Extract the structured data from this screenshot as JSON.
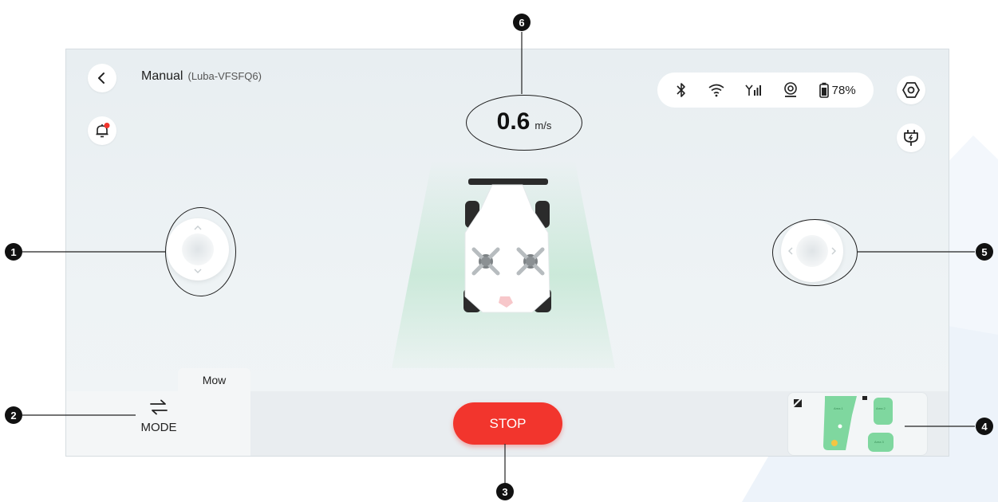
{
  "header": {
    "title": "Manual",
    "device": "(Luba-VFSFQ6)"
  },
  "status": {
    "battery": "78%",
    "icons": [
      "bluetooth-icon",
      "wifi-icon",
      "cellular-signal-icon",
      "gps-rtk-icon",
      "battery-icon"
    ]
  },
  "speed": {
    "value": "0.6",
    "unit": "m/s"
  },
  "controls": {
    "mode_tab": "Mow",
    "mode_label": "MODE",
    "stop_label": "STOP"
  },
  "minimap": {
    "zones": [
      "Area 1",
      "Area 2",
      "Area 3"
    ]
  },
  "callouts": [
    "1",
    "2",
    "3",
    "4",
    "5",
    "6"
  ],
  "colors": {
    "stop": "#f2352d",
    "zone": "#7fd79f",
    "notification_dot": "#f2352d",
    "background": "#e8eef1"
  }
}
